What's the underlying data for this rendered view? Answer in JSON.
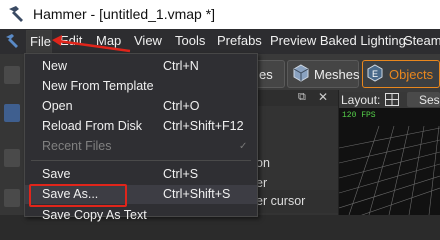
{
  "window": {
    "title": "Hammer - [untitled_1.vmap *]"
  },
  "menubar": {
    "items": [
      "File",
      "Edit",
      "Map",
      "View",
      "Tools",
      "Prefabs",
      "Preview Baked Lighting",
      "Steam"
    ]
  },
  "file_menu": {
    "items": [
      {
        "label": "New",
        "shortcut": "Ctrl+N"
      },
      {
        "label": "New From Template",
        "shortcut": ""
      },
      {
        "label": "Open",
        "shortcut": "Ctrl+O"
      },
      {
        "label": "Reload From Disk",
        "shortcut": "Ctrl+Shift+F12"
      },
      {
        "label": "Recent Files",
        "shortcut": ""
      },
      {
        "label": "Save",
        "shortcut": "Ctrl+S"
      },
      {
        "label": "Save As...",
        "shortcut": "Ctrl+Shift+S"
      },
      {
        "label": "Save Copy As Text",
        "shortcut": ""
      }
    ]
  },
  "toolbar": {
    "meshes_label": "Meshes",
    "objects_label": "Objects",
    "partial_label": "es"
  },
  "viewport": {
    "layout_label": "Layout:",
    "layout_partial": "Ses",
    "fps": "120 FPS"
  },
  "side_fragments": [
    "on",
    "er",
    "er cursor"
  ],
  "colors": {
    "highlight_red": "#e0251b",
    "objects_accent": "#e8871e",
    "fps_green": "#55d04a"
  }
}
